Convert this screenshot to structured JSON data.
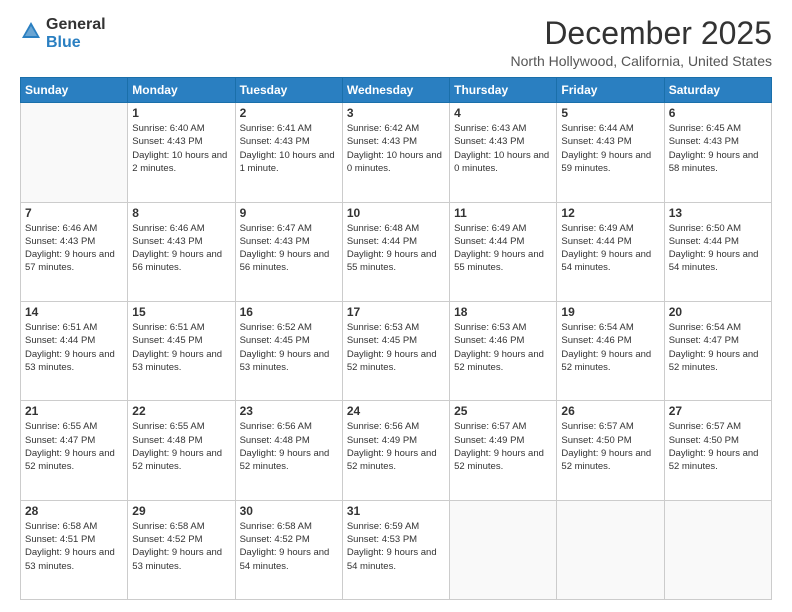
{
  "logo": {
    "general": "General",
    "blue": "Blue"
  },
  "title": "December 2025",
  "location": "North Hollywood, California, United States",
  "weekdays": [
    "Sunday",
    "Monday",
    "Tuesday",
    "Wednesday",
    "Thursday",
    "Friday",
    "Saturday"
  ],
  "weeks": [
    [
      {
        "day": "",
        "sunrise": "",
        "sunset": "",
        "daylight": ""
      },
      {
        "day": "1",
        "sunrise": "Sunrise: 6:40 AM",
        "sunset": "Sunset: 4:43 PM",
        "daylight": "Daylight: 10 hours and 2 minutes."
      },
      {
        "day": "2",
        "sunrise": "Sunrise: 6:41 AM",
        "sunset": "Sunset: 4:43 PM",
        "daylight": "Daylight: 10 hours and 1 minute."
      },
      {
        "day": "3",
        "sunrise": "Sunrise: 6:42 AM",
        "sunset": "Sunset: 4:43 PM",
        "daylight": "Daylight: 10 hours and 0 minutes."
      },
      {
        "day": "4",
        "sunrise": "Sunrise: 6:43 AM",
        "sunset": "Sunset: 4:43 PM",
        "daylight": "Daylight: 10 hours and 0 minutes."
      },
      {
        "day": "5",
        "sunrise": "Sunrise: 6:44 AM",
        "sunset": "Sunset: 4:43 PM",
        "daylight": "Daylight: 9 hours and 59 minutes."
      },
      {
        "day": "6",
        "sunrise": "Sunrise: 6:45 AM",
        "sunset": "Sunset: 4:43 PM",
        "daylight": "Daylight: 9 hours and 58 minutes."
      }
    ],
    [
      {
        "day": "7",
        "sunrise": "Sunrise: 6:46 AM",
        "sunset": "Sunset: 4:43 PM",
        "daylight": "Daylight: 9 hours and 57 minutes."
      },
      {
        "day": "8",
        "sunrise": "Sunrise: 6:46 AM",
        "sunset": "Sunset: 4:43 PM",
        "daylight": "Daylight: 9 hours and 56 minutes."
      },
      {
        "day": "9",
        "sunrise": "Sunrise: 6:47 AM",
        "sunset": "Sunset: 4:43 PM",
        "daylight": "Daylight: 9 hours and 56 minutes."
      },
      {
        "day": "10",
        "sunrise": "Sunrise: 6:48 AM",
        "sunset": "Sunset: 4:44 PM",
        "daylight": "Daylight: 9 hours and 55 minutes."
      },
      {
        "day": "11",
        "sunrise": "Sunrise: 6:49 AM",
        "sunset": "Sunset: 4:44 PM",
        "daylight": "Daylight: 9 hours and 55 minutes."
      },
      {
        "day": "12",
        "sunrise": "Sunrise: 6:49 AM",
        "sunset": "Sunset: 4:44 PM",
        "daylight": "Daylight: 9 hours and 54 minutes."
      },
      {
        "day": "13",
        "sunrise": "Sunrise: 6:50 AM",
        "sunset": "Sunset: 4:44 PM",
        "daylight": "Daylight: 9 hours and 54 minutes."
      }
    ],
    [
      {
        "day": "14",
        "sunrise": "Sunrise: 6:51 AM",
        "sunset": "Sunset: 4:44 PM",
        "daylight": "Daylight: 9 hours and 53 minutes."
      },
      {
        "day": "15",
        "sunrise": "Sunrise: 6:51 AM",
        "sunset": "Sunset: 4:45 PM",
        "daylight": "Daylight: 9 hours and 53 minutes."
      },
      {
        "day": "16",
        "sunrise": "Sunrise: 6:52 AM",
        "sunset": "Sunset: 4:45 PM",
        "daylight": "Daylight: 9 hours and 53 minutes."
      },
      {
        "day": "17",
        "sunrise": "Sunrise: 6:53 AM",
        "sunset": "Sunset: 4:45 PM",
        "daylight": "Daylight: 9 hours and 52 minutes."
      },
      {
        "day": "18",
        "sunrise": "Sunrise: 6:53 AM",
        "sunset": "Sunset: 4:46 PM",
        "daylight": "Daylight: 9 hours and 52 minutes."
      },
      {
        "day": "19",
        "sunrise": "Sunrise: 6:54 AM",
        "sunset": "Sunset: 4:46 PM",
        "daylight": "Daylight: 9 hours and 52 minutes."
      },
      {
        "day": "20",
        "sunrise": "Sunrise: 6:54 AM",
        "sunset": "Sunset: 4:47 PM",
        "daylight": "Daylight: 9 hours and 52 minutes."
      }
    ],
    [
      {
        "day": "21",
        "sunrise": "Sunrise: 6:55 AM",
        "sunset": "Sunset: 4:47 PM",
        "daylight": "Daylight: 9 hours and 52 minutes."
      },
      {
        "day": "22",
        "sunrise": "Sunrise: 6:55 AM",
        "sunset": "Sunset: 4:48 PM",
        "daylight": "Daylight: 9 hours and 52 minutes."
      },
      {
        "day": "23",
        "sunrise": "Sunrise: 6:56 AM",
        "sunset": "Sunset: 4:48 PM",
        "daylight": "Daylight: 9 hours and 52 minutes."
      },
      {
        "day": "24",
        "sunrise": "Sunrise: 6:56 AM",
        "sunset": "Sunset: 4:49 PM",
        "daylight": "Daylight: 9 hours and 52 minutes."
      },
      {
        "day": "25",
        "sunrise": "Sunrise: 6:57 AM",
        "sunset": "Sunset: 4:49 PM",
        "daylight": "Daylight: 9 hours and 52 minutes."
      },
      {
        "day": "26",
        "sunrise": "Sunrise: 6:57 AM",
        "sunset": "Sunset: 4:50 PM",
        "daylight": "Daylight: 9 hours and 52 minutes."
      },
      {
        "day": "27",
        "sunrise": "Sunrise: 6:57 AM",
        "sunset": "Sunset: 4:50 PM",
        "daylight": "Daylight: 9 hours and 52 minutes."
      }
    ],
    [
      {
        "day": "28",
        "sunrise": "Sunrise: 6:58 AM",
        "sunset": "Sunset: 4:51 PM",
        "daylight": "Daylight: 9 hours and 53 minutes."
      },
      {
        "day": "29",
        "sunrise": "Sunrise: 6:58 AM",
        "sunset": "Sunset: 4:52 PM",
        "daylight": "Daylight: 9 hours and 53 minutes."
      },
      {
        "day": "30",
        "sunrise": "Sunrise: 6:58 AM",
        "sunset": "Sunset: 4:52 PM",
        "daylight": "Daylight: 9 hours and 54 minutes."
      },
      {
        "day": "31",
        "sunrise": "Sunrise: 6:59 AM",
        "sunset": "Sunset: 4:53 PM",
        "daylight": "Daylight: 9 hours and 54 minutes."
      },
      {
        "day": "",
        "sunrise": "",
        "sunset": "",
        "daylight": ""
      },
      {
        "day": "",
        "sunrise": "",
        "sunset": "",
        "daylight": ""
      },
      {
        "day": "",
        "sunrise": "",
        "sunset": "",
        "daylight": ""
      }
    ]
  ]
}
